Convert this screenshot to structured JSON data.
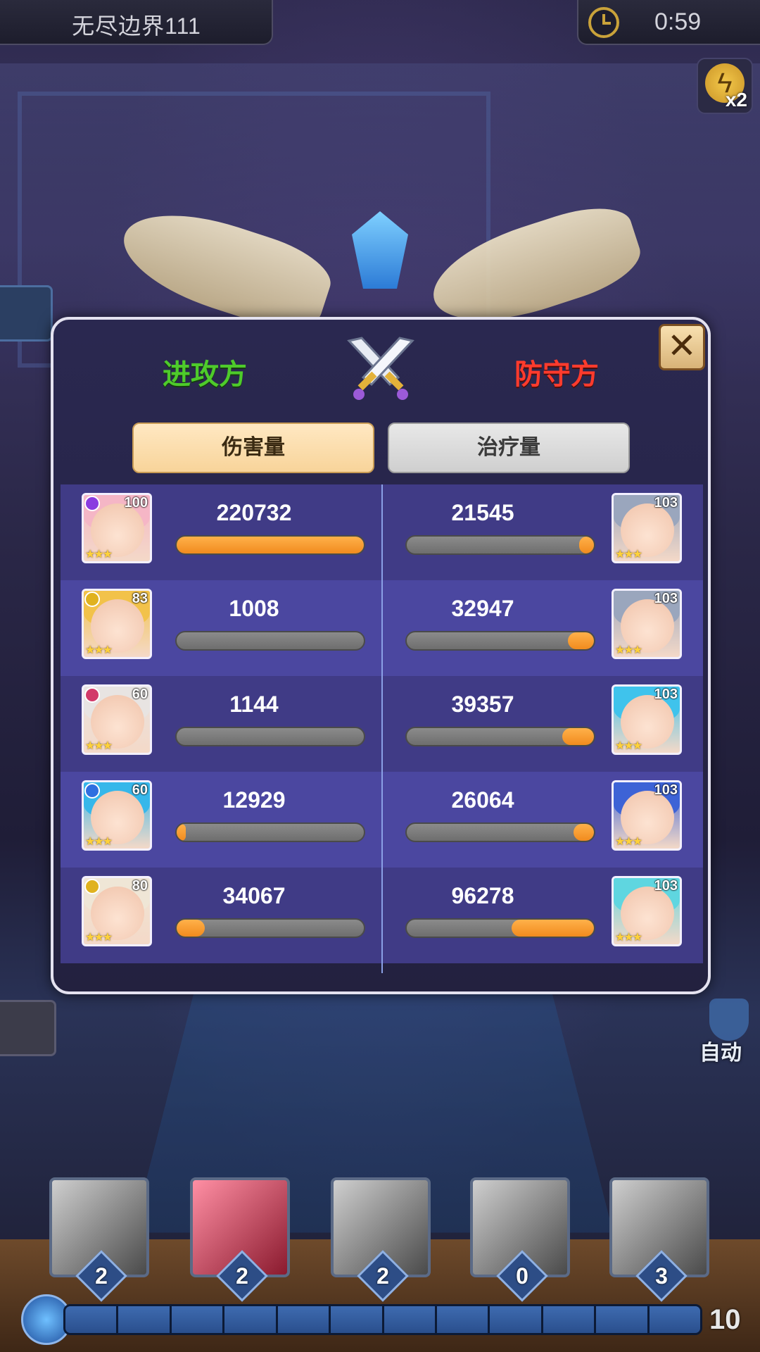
{
  "title": "无尽边界111",
  "timer": "0:59",
  "speed": "x2",
  "auto_label": "自动",
  "panel": {
    "attacker_label": "进攻方",
    "defender_label": "防守方",
    "close_icon": "close-icon",
    "tabs": {
      "damage": "伤害量",
      "heal": "治疗量"
    },
    "rows": [
      {
        "left": {
          "level": "100",
          "value": "220732",
          "fraction": 1.0,
          "hair": "#f5b6c6",
          "badge": "#8b3be0"
        },
        "right": {
          "level": "103",
          "value": "21545",
          "fraction": 0.08,
          "hair": "#9aa6bd",
          "badge": ""
        }
      },
      {
        "left": {
          "level": "83",
          "value": "1008",
          "fraction": 0.0,
          "hair": "#f2c24a",
          "badge": "#e0b21f"
        },
        "right": {
          "level": "103",
          "value": "32947",
          "fraction": 0.14,
          "hair": "#9aa6bd",
          "badge": ""
        }
      },
      {
        "left": {
          "level": "60",
          "value": "1144",
          "fraction": 0.0,
          "hair": "#e8e4e2",
          "badge": "#d23a6a"
        },
        "right": {
          "level": "103",
          "value": "39357",
          "fraction": 0.17,
          "hair": "#3fc3ec",
          "badge": ""
        }
      },
      {
        "left": {
          "level": "60",
          "value": "12929",
          "fraction": 0.05,
          "hair": "#36b7ea",
          "badge": "#2f6fe0"
        },
        "right": {
          "level": "103",
          "value": "26064",
          "fraction": 0.11,
          "hair": "#3d63d6",
          "badge": ""
        }
      },
      {
        "left": {
          "level": "80",
          "value": "34067",
          "fraction": 0.15,
          "hair": "#efe6d6",
          "badge": "#e0b21f"
        },
        "right": {
          "level": "103",
          "value": "96278",
          "fraction": 0.44,
          "hair": "#5fd6e0",
          "badge": ""
        }
      }
    ]
  },
  "skills": [
    {
      "name": "skill-sword",
      "count": "2"
    },
    {
      "name": "skill-slash",
      "count": "2"
    },
    {
      "name": "skill-bomb",
      "count": "2"
    },
    {
      "name": "skill-phoenix",
      "count": "0"
    },
    {
      "name": "skill-moon",
      "count": "3"
    }
  ],
  "energy": "10",
  "colors": {
    "attacker": "#4ecb2b",
    "defender": "#ff3b2d",
    "bar_fill": "#f18b1e"
  }
}
